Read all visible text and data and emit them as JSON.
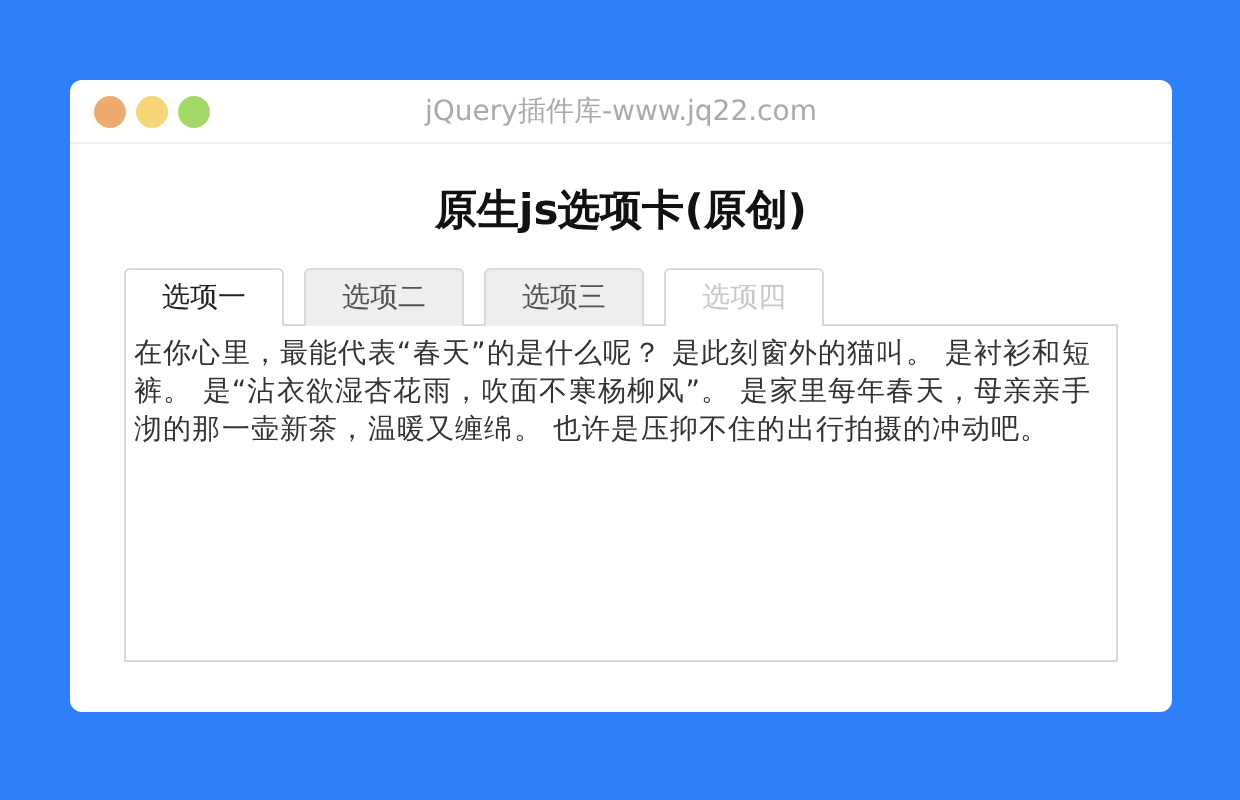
{
  "window": {
    "title": "jQuery插件库-www.jq22.com"
  },
  "heading": "原生js选项卡(原创)",
  "tabs": [
    {
      "label": "选项一",
      "selected": true,
      "disabled": false
    },
    {
      "label": "选项二",
      "selected": false,
      "disabled": false
    },
    {
      "label": "选项三",
      "selected": false,
      "disabled": false
    },
    {
      "label": "选项四",
      "selected": false,
      "disabled": true
    }
  ],
  "panel": {
    "text": "在你心里，最能代表“春天”的是什么呢？ 是此刻窗外的猫叫。 是衬衫和短裤。 是“沾衣欲湿杏花雨，吹面不寒杨柳风”。 是家里每年春天，母亲亲手沏的那一壶新茶，温暖又缠绵。 也许是压抑不住的出行拍摄的冲动吧。"
  }
}
